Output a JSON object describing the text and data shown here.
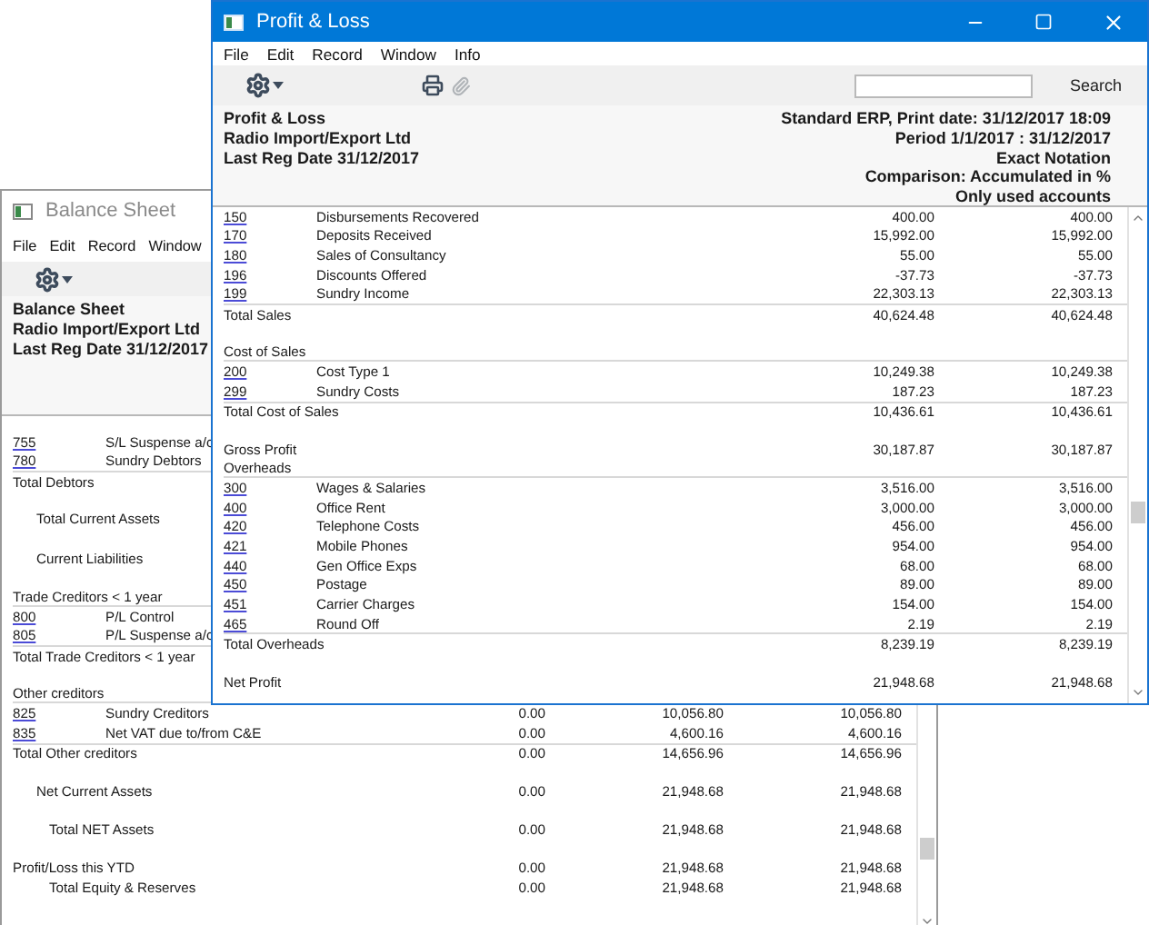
{
  "balance_sheet_window": {
    "title": "Balance Sheet",
    "active": false,
    "menu": [
      "File",
      "Edit",
      "Record",
      "Window"
    ],
    "header_lines": [
      "Balance Sheet",
      "Radio Import/Export Ltd",
      "Last Reg Date  31/12/2017"
    ],
    "rows": [
      {
        "kind": "account",
        "code": "755",
        "label": "S/L Suspense a/c"
      },
      {
        "kind": "account",
        "code": "780",
        "label": "Sundry Debtors"
      },
      {
        "kind": "total",
        "label": "Total Debtors"
      },
      {
        "kind": "gap"
      },
      {
        "kind": "indent",
        "label": "Total Current Assets"
      },
      {
        "kind": "gap"
      },
      {
        "kind": "indent",
        "label": "Current Liabilities"
      },
      {
        "kind": "gap"
      },
      {
        "kind": "section",
        "label": "Trade Creditors < 1 year"
      },
      {
        "kind": "account",
        "code": "800",
        "label": "P/L Control"
      },
      {
        "kind": "account",
        "code": "805",
        "label": "P/L Suspense a/c"
      },
      {
        "kind": "total",
        "label": "Total Trade Creditors < 1 year"
      },
      {
        "kind": "gap"
      },
      {
        "kind": "section",
        "label": "Other creditors"
      },
      {
        "kind": "account",
        "code": "825",
        "label": "Sundry Creditors",
        "values": [
          "0.00",
          "10,056.80",
          "10,056.80"
        ]
      },
      {
        "kind": "account",
        "code": "835",
        "label": "Net VAT due to/from C&E",
        "values": [
          "0.00",
          "4,600.16",
          "4,600.16"
        ]
      },
      {
        "kind": "total",
        "label": "Total Other creditors",
        "values": [
          "0.00",
          "14,656.96",
          "14,656.96"
        ]
      },
      {
        "kind": "gap"
      },
      {
        "kind": "indent",
        "label": "Net Current Assets",
        "values": [
          "0.00",
          "21,948.68",
          "21,948.68"
        ]
      },
      {
        "kind": "gap"
      },
      {
        "kind": "indent2",
        "label": "Total NET Assets",
        "values": [
          "0.00",
          "21,948.68",
          "21,948.68"
        ]
      },
      {
        "kind": "gap"
      },
      {
        "kind": "plain",
        "label": "Profit/Loss this YTD",
        "values": [
          "0.00",
          "21,948.68",
          "21,948.68"
        ]
      },
      {
        "kind": "indent2",
        "label": "Total Equity & Reserves",
        "values": [
          "0.00",
          "21,948.68",
          "21,948.68"
        ]
      }
    ]
  },
  "profit_loss_window": {
    "title": "Profit & Loss",
    "active": true,
    "menu": [
      "File",
      "Edit",
      "Record",
      "Window",
      "Info"
    ],
    "search_button": "Search",
    "header_left": [
      "Profit & Loss",
      "Radio Import/Export Ltd",
      "Last Reg Date  31/12/2017"
    ],
    "header_right": [
      "Standard ERP, Print date: 31/12/2017 18:09",
      "Period  1/1/2017 : 31/12/2017",
      "Exact Notation",
      "Comparison: Accumulated in %",
      "Only used accounts"
    ],
    "rows": [
      {
        "kind": "account",
        "code": "150",
        "label": "Disbursements Recovered",
        "values": [
          "400.00",
          "400.00"
        ]
      },
      {
        "kind": "account",
        "code": "170",
        "label": "Deposits Received",
        "values": [
          "15,992.00",
          "15,992.00"
        ]
      },
      {
        "kind": "account",
        "code": "180",
        "label": "Sales of Consultancy",
        "values": [
          "55.00",
          "55.00"
        ]
      },
      {
        "kind": "account",
        "code": "196",
        "label": "Discounts Offered",
        "values": [
          "-37.73",
          "-37.73"
        ]
      },
      {
        "kind": "account",
        "code": "199",
        "label": "Sundry Income",
        "values": [
          "22,303.13",
          "22,303.13"
        ]
      },
      {
        "kind": "total",
        "label": "Total Sales",
        "values": [
          "40,624.48",
          "40,624.48"
        ]
      },
      {
        "kind": "gap"
      },
      {
        "kind": "section",
        "label": "Cost of Sales"
      },
      {
        "kind": "account",
        "code": "200",
        "label": "Cost Type 1",
        "values": [
          "10,249.38",
          "10,249.38"
        ]
      },
      {
        "kind": "account",
        "code": "299",
        "label": "Sundry Costs",
        "values": [
          "187.23",
          "187.23"
        ]
      },
      {
        "kind": "total",
        "label": "Total Cost of Sales",
        "values": [
          "10,436.61",
          "10,436.61"
        ]
      },
      {
        "kind": "gap"
      },
      {
        "kind": "plain",
        "label": "Gross Profit",
        "values": [
          "30,187.87",
          "30,187.87"
        ]
      },
      {
        "kind": "section",
        "label": "Overheads"
      },
      {
        "kind": "account",
        "code": "300",
        "label": "Wages & Salaries",
        "values": [
          "3,516.00",
          "3,516.00"
        ]
      },
      {
        "kind": "account",
        "code": "400",
        "label": "Office Rent",
        "values": [
          "3,000.00",
          "3,000.00"
        ]
      },
      {
        "kind": "account",
        "code": "420",
        "label": "Telephone Costs",
        "values": [
          "456.00",
          "456.00"
        ]
      },
      {
        "kind": "account",
        "code": "421",
        "label": "Mobile Phones",
        "values": [
          "954.00",
          "954.00"
        ]
      },
      {
        "kind": "account",
        "code": "440",
        "label": "Gen Office Exps",
        "values": [
          "68.00",
          "68.00"
        ]
      },
      {
        "kind": "account",
        "code": "450",
        "label": "Postage",
        "values": [
          "89.00",
          "89.00"
        ]
      },
      {
        "kind": "account",
        "code": "451",
        "label": "Carrier Charges",
        "values": [
          "154.00",
          "154.00"
        ]
      },
      {
        "kind": "account",
        "code": "465",
        "label": "Round Off",
        "values": [
          "2.19",
          "2.19"
        ]
      },
      {
        "kind": "total",
        "label": "Total Overheads",
        "values": [
          "8,239.19",
          "8,239.19"
        ]
      },
      {
        "kind": "gap"
      },
      {
        "kind": "plain",
        "label": "Net Profit",
        "values": [
          "21,948.68",
          "21,948.68"
        ]
      }
    ]
  }
}
